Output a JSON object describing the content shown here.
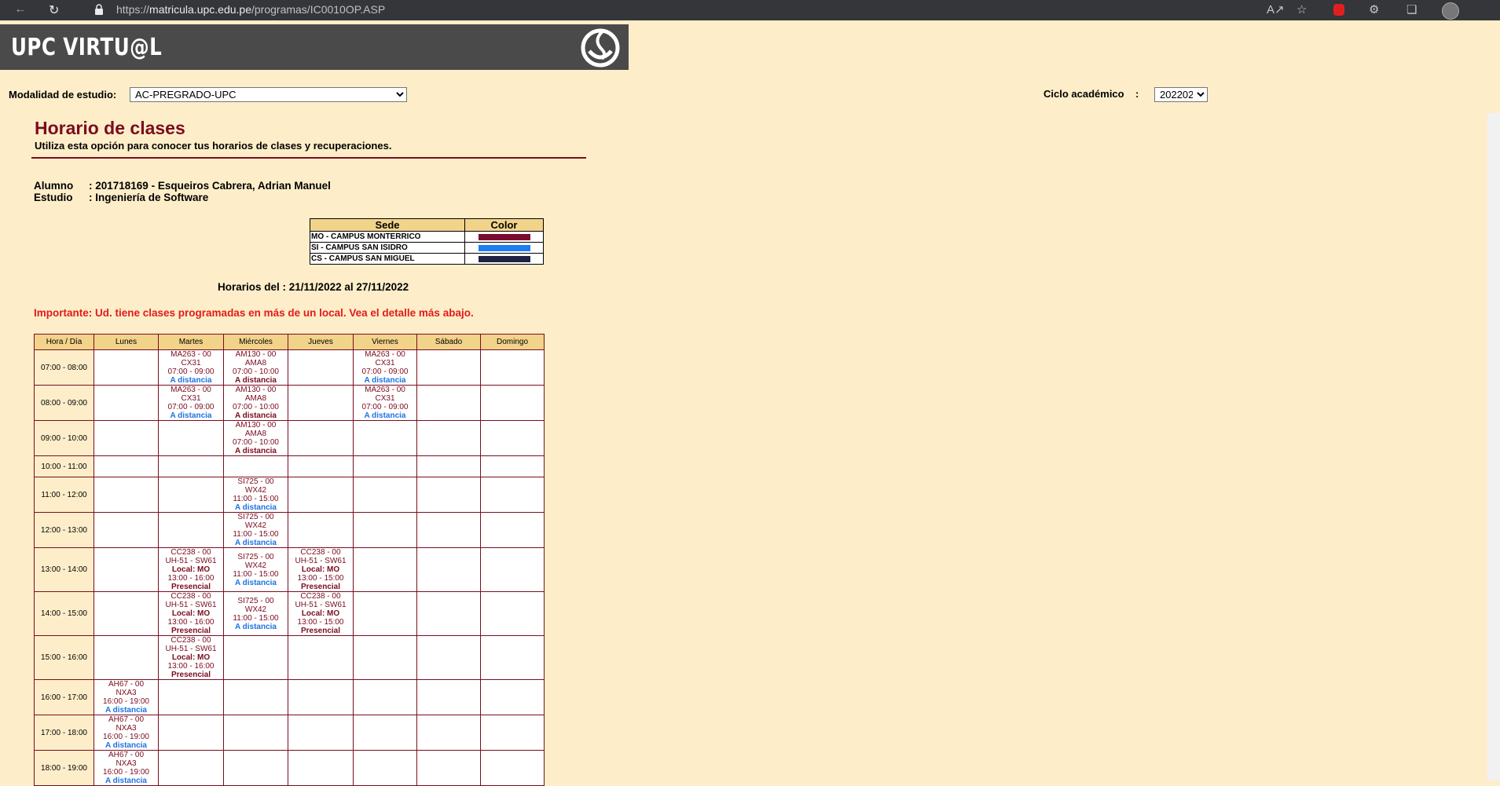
{
  "browser": {
    "url_scheme": "https://",
    "url_host": "matricula.upc.edu.pe",
    "url_path": "/programas/IC0010OP.ASP"
  },
  "header": {
    "logo_text": "UPC VIRTU@L"
  },
  "filters": {
    "modalidad_label": "Modalidad de estudio:",
    "modalidad_value": "AC-PREGRADO-UPC",
    "ciclo_label": "Ciclo académico    :",
    "ciclo_value": "202202"
  },
  "page": {
    "title": "Horario de clases",
    "subtitle": "Utiliza esta opción para conocer tus horarios de clases y recuperaciones.",
    "alumno_label": "Alumno",
    "alumno_value": ": 201718169 - Esqueiros Cabrera, Adrian Manuel",
    "estudio_label": "Estudio",
    "estudio_value": ": Ingeniería de Software",
    "range_text": "Horarios del : 21/11/2022 al 27/11/2022",
    "warning": "Importante: Ud. tiene clases programadas en más de un local. Vea el detalle más abajo."
  },
  "sede_legend": {
    "headers": [
      "Sede",
      "Color"
    ],
    "rows": [
      {
        "name": "MO - CAMPUS MONTERRICO",
        "color": "#7b0c2e"
      },
      {
        "name": "SI - CAMPUS SAN ISIDRO",
        "color": "#1e7df0"
      },
      {
        "name": "CS - CAMPUS SAN MIGUEL",
        "color": "#1e2346"
      }
    ]
  },
  "schedule": {
    "headers": [
      "Hora / Día",
      "Lunes",
      "Martes",
      "Miércoles",
      "Jueves",
      "Viernes",
      "Sábado",
      "Domingo"
    ],
    "rows": [
      {
        "hour": "07:00 - 08:00",
        "cells": [
          [],
          [
            [
              "MA263 - 00",
              "CX31",
              "07:00 - 09:00"
            ],
            "A distancia"
          ],
          [
            [
              "AM130 - 00",
              "AMA8",
              "07:00 - 10:00"
            ],
            "A distancia_p"
          ],
          [],
          [
            [
              "MA263 - 00",
              "CX31",
              "07:00 - 09:00"
            ],
            "A distancia"
          ],
          [],
          []
        ]
      },
      {
        "hour": "08:00 - 09:00",
        "cells": [
          [],
          [
            [
              "MA263 - 00",
              "CX31",
              "07:00 - 09:00"
            ],
            "A distancia"
          ],
          [
            [
              "AM130 - 00",
              "AMA8",
              "07:00 - 10:00"
            ],
            "A distancia_p"
          ],
          [],
          [
            [
              "MA263 - 00",
              "CX31",
              "07:00 - 09:00"
            ],
            "A distancia"
          ],
          [],
          []
        ]
      },
      {
        "hour": "09:00 - 10:00",
        "cells": [
          [],
          [],
          [
            [
              "AM130 - 00",
              "AMA8",
              "07:00 - 10:00"
            ],
            "A distancia_p"
          ],
          [],
          [],
          [],
          []
        ]
      },
      {
        "hour": "10:00 - 11:00",
        "cells": [
          [],
          [],
          [],
          [],
          [],
          [],
          []
        ]
      },
      {
        "hour": "11:00 - 12:00",
        "cells": [
          [],
          [],
          [
            [
              "SI725 - 00",
              "WX42",
              "11:00 - 15:00"
            ],
            "A distancia"
          ],
          [],
          [],
          [],
          []
        ]
      },
      {
        "hour": "12:00 - 13:00",
        "cells": [
          [],
          [],
          [
            [
              "SI725 - 00",
              "WX42",
              "11:00 - 15:00"
            ],
            "A distancia"
          ],
          [],
          [],
          [],
          []
        ]
      },
      {
        "hour": "13:00 - 14:00",
        "cells": [
          [],
          [
            [
              "CC238 - 00",
              "UH-51 - SW61",
              "Local: MO",
              "13:00 - 16:00"
            ],
            "Presencial"
          ],
          [
            [
              "SI725 - 00",
              "WX42",
              "11:00 - 15:00"
            ],
            "A distancia"
          ],
          [
            [
              "CC238 - 00",
              "UH-51 - SW61",
              "Local: MO",
              "13:00 - 15:00"
            ],
            "Presencial"
          ],
          [],
          [],
          []
        ]
      },
      {
        "hour": "14:00 - 15:00",
        "cells": [
          [],
          [
            [
              "CC238 - 00",
              "UH-51 - SW61",
              "Local: MO",
              "13:00 - 16:00"
            ],
            "Presencial"
          ],
          [
            [
              "SI725 - 00",
              "WX42",
              "11:00 - 15:00"
            ],
            "A distancia"
          ],
          [
            [
              "CC238 - 00",
              "UH-51 - SW61",
              "Local: MO",
              "13:00 - 15:00"
            ],
            "Presencial"
          ],
          [],
          [],
          []
        ]
      },
      {
        "hour": "15:00 - 16:00",
        "cells": [
          [],
          [
            [
              "CC238 - 00",
              "UH-51 - SW61",
              "Local: MO",
              "13:00 - 16:00"
            ],
            "Presencial"
          ],
          [],
          [],
          [],
          [],
          []
        ]
      },
      {
        "hour": "16:00 - 17:00",
        "cells": [
          [
            [
              "AH67 - 00",
              "NXA3",
              "16:00 - 19:00"
            ],
            "A distancia"
          ],
          [],
          [],
          [],
          [],
          [],
          []
        ]
      },
      {
        "hour": "17:00 - 18:00",
        "cells": [
          [
            [
              "AH67 - 00",
              "NXA3",
              "16:00 - 19:00"
            ],
            "A distancia"
          ],
          [],
          [],
          [],
          [],
          [],
          []
        ]
      },
      {
        "hour": "18:00 - 19:00",
        "cells": [
          [
            [
              "AH67 - 00",
              "NXA3",
              "16:00 - 19:00"
            ],
            "A distancia"
          ],
          [],
          [],
          [],
          [],
          [],
          []
        ]
      }
    ]
  }
}
